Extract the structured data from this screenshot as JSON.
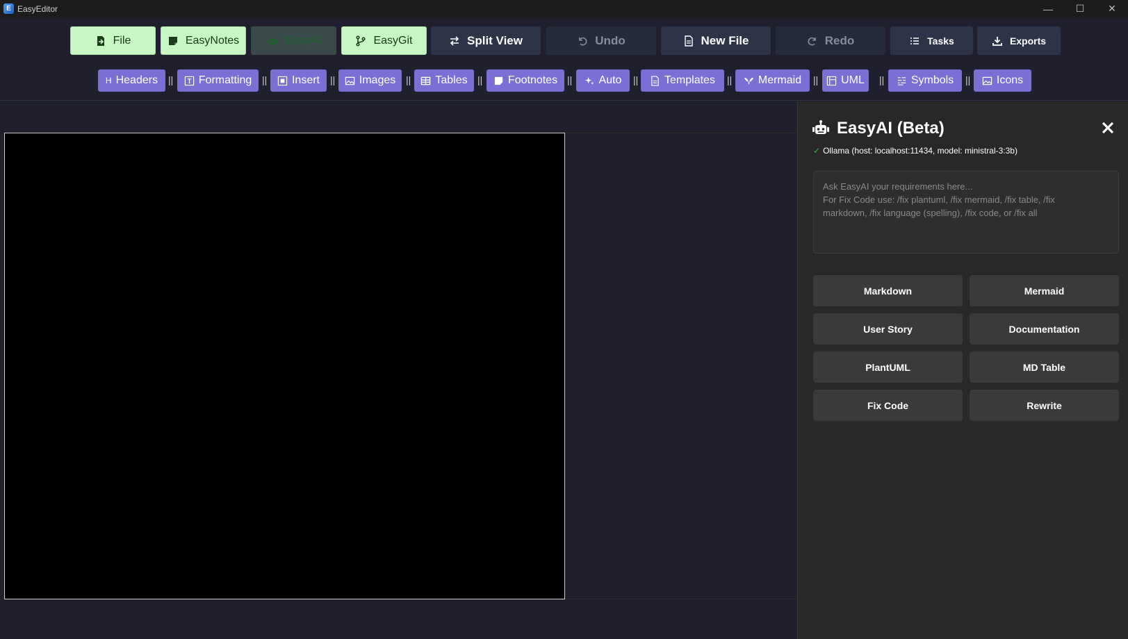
{
  "window": {
    "title": "EasyEditor",
    "app_icon_letter": "E",
    "controls": {
      "minimize": "—",
      "maximize": "☐",
      "close": "✕"
    }
  },
  "toolbar": {
    "file": "File",
    "easynotes": "EasyNotes",
    "easyai": "EasyAI",
    "easygit": "EasyGit",
    "split_view": "Split View",
    "undo": "Undo",
    "new_file": "New File",
    "redo": "Redo",
    "tasks": "Tasks",
    "exports": "Exports"
  },
  "format_bar": {
    "headers_prefix": "H",
    "headers": "Headers",
    "formatting": "Formatting",
    "insert": "Insert",
    "images": "Images",
    "tables": "Tables",
    "footnotes": "Footnotes",
    "auto": "Auto",
    "templates": "Templates",
    "mermaid": "Mermaid",
    "uml": "UML",
    "symbols": "Symbols",
    "icons": "Icons",
    "separator": "||"
  },
  "ai_panel": {
    "title": "EasyAI (Beta)",
    "close": "✕",
    "status_check": "✓",
    "status": "Ollama (host: localhost:11434, model: ministral-3:3b)",
    "placeholder": "Ask EasyAI your requirements here...\nFor Fix Code use: /fix plantuml, /fix mermaid, /fix table, /fix\nmarkdown, /fix language (spelling), /fix code, or /fix all",
    "buttons": {
      "markdown": "Markdown",
      "mermaid": "Mermaid",
      "user_story": "User Story",
      "documentation": "Documentation",
      "plantuml": "PlantUML",
      "md_table": "MD Table",
      "fix_code": "Fix Code",
      "rewrite": "Rewrite"
    }
  },
  "colors": {
    "green_button": "#c8f7c5",
    "purple_button": "#7b6fd6",
    "dark_button": "#2d3448",
    "background": "#1f1f2e",
    "panel": "#282828"
  }
}
